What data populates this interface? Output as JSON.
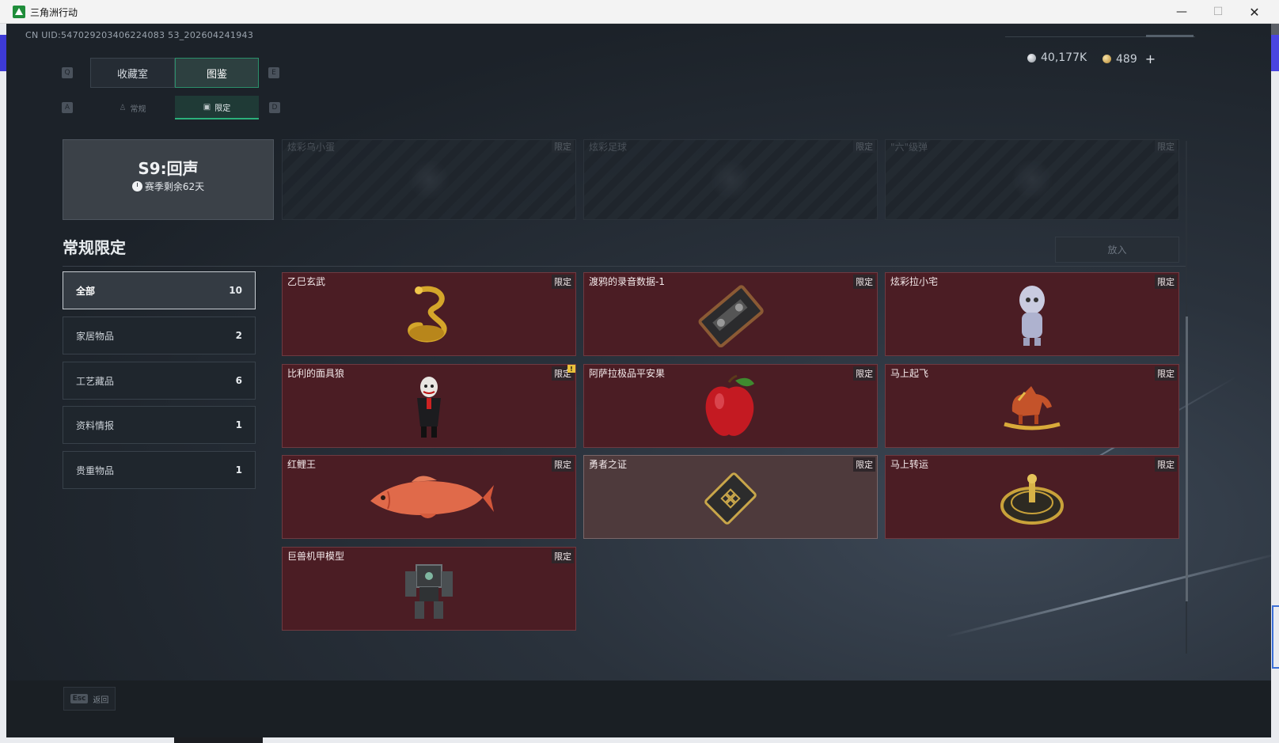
{
  "window": {
    "title": "三角洲行动",
    "minimize": "—",
    "maximize": "☐",
    "close": "✕"
  },
  "uid": "CN UID:547029203406224083 53_202604241943",
  "currency": {
    "silver": "40,177K",
    "gold": "489",
    "plus": "+"
  },
  "keyhints": {
    "q": "Q",
    "e": "E",
    "a": "A",
    "d": "D"
  },
  "tabs": {
    "main": [
      "收藏室",
      "图鉴"
    ],
    "sub": [
      "常规",
      "限定"
    ]
  },
  "season": {
    "title": "S9:回声",
    "remaining": "赛季剩余62天"
  },
  "top_slots": [
    {
      "name": "炫彩乌小蛋",
      "tag": "限定"
    },
    {
      "name": "炫彩足球",
      "tag": "限定"
    },
    {
      "name": "\"六\"级弹",
      "tag": "限定"
    }
  ],
  "section": {
    "title": "常规限定",
    "put_button": "放入"
  },
  "categories": [
    {
      "label": "全部",
      "count": "10"
    },
    {
      "label": "家居物品",
      "count": "2"
    },
    {
      "label": "工艺藏品",
      "count": "6"
    },
    {
      "label": "资料情报",
      "count": "1"
    },
    {
      "label": "贵重物品",
      "count": "1"
    }
  ],
  "items": [
    {
      "name": "乙巳玄武",
      "tag": "限定",
      "icon": "golden-snake-icon"
    },
    {
      "name": "渡鸦的录音数据-1",
      "tag": "限定",
      "icon": "cassette-icon"
    },
    {
      "name": "炫彩拉小宅",
      "tag": "限定",
      "icon": "figurine-icon"
    },
    {
      "name": "比利的面具狼",
      "tag": "限定",
      "icon": "puppet-icon",
      "warn": "!"
    },
    {
      "name": "阿萨拉极品平安果",
      "tag": "限定",
      "icon": "apple-icon"
    },
    {
      "name": "马上起飞",
      "tag": "限定",
      "icon": "horse-icon"
    },
    {
      "name": "红鲤王",
      "tag": "限定",
      "icon": "carp-icon"
    },
    {
      "name": "勇者之证",
      "tag": "限定",
      "icon": "badge-card-icon"
    },
    {
      "name": "马上转运",
      "tag": "限定",
      "icon": "wheel-icon"
    },
    {
      "name": "巨兽机甲模型",
      "tag": "限定",
      "icon": "mech-icon"
    }
  ],
  "footer": {
    "esc_key": "Esc",
    "back": "返回"
  }
}
